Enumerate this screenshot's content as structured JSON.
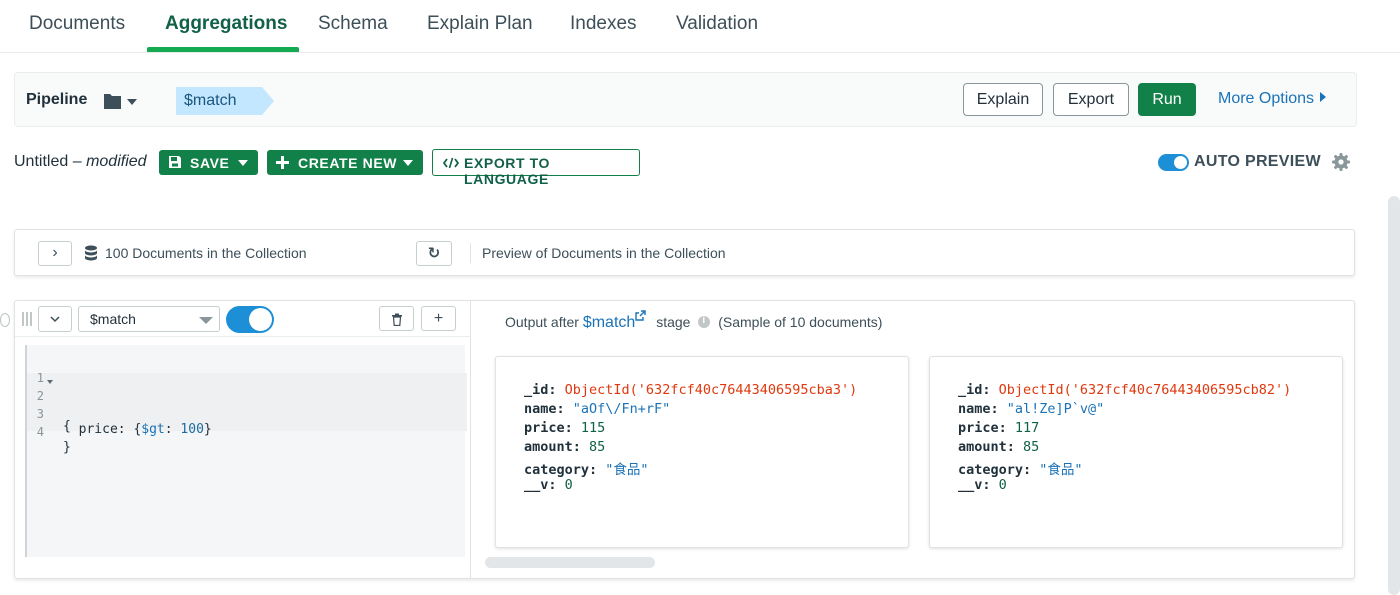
{
  "tabs": [
    {
      "label": "Documents"
    },
    {
      "label": "Aggregations"
    },
    {
      "label": "Schema"
    },
    {
      "label": "Explain Plan"
    },
    {
      "label": "Indexes"
    },
    {
      "label": "Validation"
    }
  ],
  "active_tab": "Aggregations",
  "pipeline_bar": {
    "label": "Pipeline",
    "stage_chip": "$match",
    "explain_label": "Explain",
    "export_label": "Export",
    "run_label": "Run",
    "more_options_label": "More Options"
  },
  "toolbar": {
    "title": "Untitled",
    "dash": "–",
    "modified": "modified",
    "save_label": "SAVE",
    "create_new_label": "CREATE NEW",
    "export_language_label": "EXPORT TO LANGUAGE",
    "auto_preview_label": "AUTO PREVIEW",
    "auto_preview_on": true
  },
  "collection_row": {
    "expand_glyph": "›",
    "count_text": "100 Documents in the Collection",
    "refresh_glyph": "↻",
    "preview_text": "Preview of Documents in the Collection"
  },
  "stage": {
    "collapse_glyph": "⌄",
    "operator": "$match",
    "enabled": true,
    "delete_glyph": "🗑",
    "add_glyph": "+",
    "code_lines": [
      {
        "num": "1",
        "text": ""
      },
      {
        "num": "2",
        "text": "{"
      },
      {
        "num": "3",
        "text": "  price: {$gt: 100}"
      },
      {
        "num": "4",
        "text": "}"
      }
    ],
    "output_prefix": "Output after",
    "output_stage": "$match",
    "output_suffix": "stage",
    "sample_text": "(Sample of 10 documents)"
  },
  "documents": [
    {
      "_id_key": "_id:",
      "_id": "ObjectId('632fcf40c76443406595cba3')",
      "name_key": "name:",
      "name": "\"aOf\\/Fn+rF\"",
      "price_key": "price:",
      "price": "115",
      "amount_key": "amount:",
      "amount": "85",
      "category_key": "category:",
      "category": "\"食品\"",
      "v_key": "__v:",
      "v": "0"
    },
    {
      "_id_key": "_id:",
      "_id": "ObjectId('632fcf40c76443406595cb82')",
      "name_key": "name:",
      "name": "\"al!Ze]P`v@\"",
      "price_key": "price:",
      "price": "117",
      "amount_key": "amount:",
      "amount": "85",
      "category_key": "category:",
      "category": "\"食品\"",
      "v_key": "__v:",
      "v": "0"
    }
  ],
  "colors": {
    "brand_green": "#13aa52",
    "dark_green": "#128049",
    "link_blue": "#1a73b8",
    "toggle_blue": "#1c8fd6",
    "chip_blue": "#c3e7fe",
    "objectid_red": "#e0380e"
  },
  "icons": {
    "folder": "folder-icon",
    "gear": "gear-icon",
    "database": "database-icon",
    "refresh": "refresh-icon",
    "trash": "trash-icon",
    "plus": "plus-icon",
    "external_link": "external-link-icon",
    "info": "info-icon",
    "save": "floppy-icon",
    "code": "code-icon"
  }
}
